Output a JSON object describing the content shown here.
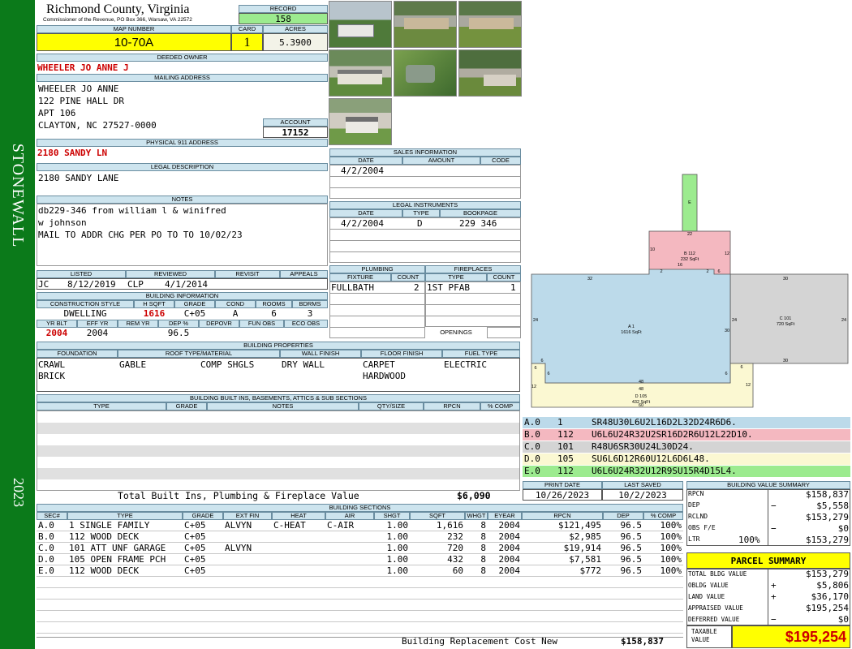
{
  "side_banner": {
    "district": "STONEWALL",
    "year": "2023"
  },
  "header": {
    "county": "Richmond County, Virginia",
    "address": "Commissioner of the Revenue, PO Box 366, Warsaw, VA 22572",
    "record_label": "RECORD",
    "record": "158",
    "map_number_label": "MAP NUMBER",
    "map_number": "10-70A",
    "card_label": "CARD",
    "card": "1",
    "acres_label": "ACRES",
    "acres": "5.3900"
  },
  "owner": {
    "deeded_owner_label": "DEEDED OWNER",
    "deeded_owner": "WHEELER JO ANNE J",
    "mailing_label": "MAILING ADDRESS",
    "mailing": [
      "WHEELER JO ANNE",
      "122 PINE HALL DR",
      "APT 106",
      "CLAYTON, NC 27527-0000"
    ],
    "account_label": "ACCOUNT",
    "account": "17152",
    "address911_label": "PHYSICAL 911 ADDRESS",
    "address911": "2180 SANDY LN",
    "legal_label": "LEGAL DESCRIPTION",
    "legal": "2180 SANDY LANE",
    "notes_label": "NOTES",
    "notes": [
      "db229-346 from william l & winifred",
      "w johnson",
      "MAIL TO ADDR CHG PER PO TO TO 10/02/23"
    ]
  },
  "review": {
    "headers": [
      "LISTED",
      "REVIEWED",
      "REVISIT",
      "APPEALS"
    ],
    "listed_by": "JC",
    "listed_date": "8/12/2019",
    "reviewed_by": "CLP",
    "reviewed_date": "4/1/2014"
  },
  "building_info": {
    "title": "BUILDING INFORMATION",
    "headers1": [
      "CONSTRUCTION STYLE",
      "H SQFT",
      "GRADE",
      "COND",
      "ROOMS",
      "BDRMS"
    ],
    "values1": [
      "DWELLING",
      "1616",
      "C+05",
      "A",
      "6",
      "3"
    ],
    "headers2": [
      "YR BLT",
      "EFF YR",
      "REM YR",
      "DEP %",
      "DEPOVR",
      "FUN OBS",
      "ECO OBS"
    ],
    "values2": [
      "2004",
      "2004",
      "",
      "96.5",
      "",
      "",
      ""
    ]
  },
  "properties": {
    "title": "BUILDING PROPERTIES",
    "headers": [
      "FOUNDATION",
      "ROOF TYPE/MATERIAL",
      "WALL FINISH",
      "FLOOR FINISH",
      "FUEL TYPE"
    ],
    "foundation": [
      "CRAWL",
      "BRICK"
    ],
    "roof_type": "GABLE",
    "roof_material": "COMP SHGLS",
    "wall": "DRY WALL",
    "floor": [
      "CARPET",
      "HARDWOOD"
    ],
    "fuel": "ELECTRIC"
  },
  "builtins": {
    "title": "BUILDING BUILT INS, BASEMENTS, ATTICS & SUB SECTIONS",
    "headers": [
      "TYPE",
      "GRADE",
      "NOTES",
      "QTY/SIZE",
      "RPCN",
      "% COMP"
    ],
    "total_label": "Total Built Ins, Plumbing & Fireplace Value",
    "total": "$6,090"
  },
  "sales": {
    "title": "SALES INFORMATION",
    "headers": [
      "DATE",
      "AMOUNT",
      "CODE"
    ],
    "date": "4/2/2004"
  },
  "instruments": {
    "title": "LEGAL INSTRUMENTS",
    "headers": [
      "DATE",
      "TYPE",
      "BOOKPAGE"
    ],
    "date": "4/2/2004",
    "type": "D",
    "bookpage": "229 346"
  },
  "plumbing": {
    "title": "PLUMBING",
    "headers": [
      "FIXTURE",
      "COUNT"
    ],
    "fixture": "FULLBATH",
    "count": "2"
  },
  "fireplaces": {
    "title": "FIREPLACES",
    "headers": [
      "TYPE",
      "COUNT"
    ],
    "type": "1ST PFAB",
    "count": "1",
    "openings_label": "OPENINGS"
  },
  "sketch": {
    "area_a": "A 1",
    "area_a_sqft": "1616 SqFt",
    "area_b": "B 112",
    "area_b_sqft": "232 SqFt",
    "area_c": "C 101",
    "area_c_sqft": "720 SqFt",
    "area_d": "D 105",
    "area_d_sqft": "432 SqFt",
    "area_e": "E",
    "dims": [
      "32",
      "30",
      "24",
      "24",
      "24",
      "12",
      "22",
      "10",
      "2",
      "16",
      "2",
      "6",
      "12",
      "30",
      "48",
      "48",
      "60",
      "6",
      "6",
      "6",
      "6",
      "12",
      "6",
      "30"
    ]
  },
  "vectors": [
    {
      "sec": "A.0",
      "code": "1",
      "vec": "SR48U30L6U2L16D2L32D24R6D6.",
      "color": "#bcdaea"
    },
    {
      "sec": "B.0",
      "code": "112",
      "vec": "U6L6U24R32U2SR16D2R6U12L22D10.",
      "color": "#f4b8c0"
    },
    {
      "sec": "C.0",
      "code": "101",
      "vec": "R48U6SR30U24L30D24.",
      "color": "#d4d4d4"
    },
    {
      "sec": "D.0",
      "code": "105",
      "vec": "SU6L6D12R60U12L6D6L48.",
      "color": "#fbf8d2"
    },
    {
      "sec": "E.0",
      "code": "112",
      "vec": "U6L6U24R32U12R9SU15R4D15L4.",
      "color": "#9ceb8f"
    }
  ],
  "dates": {
    "print_label": "PRINT DATE",
    "print": "10/26/2023",
    "saved_label": "LAST SAVED",
    "saved": "10/2/2023"
  },
  "sections": {
    "title": "BUILDING SECTIONS",
    "headers": [
      "SEC#",
      "TYPE",
      "GRADE",
      "EXT FIN",
      "HEAT",
      "AIR",
      "SHGT",
      "SQFT",
      "WHGT",
      "EYEAR",
      "RPCN",
      "DEP",
      "% COMP"
    ],
    "rows": [
      [
        "A.0",
        "1 SINGLE FAMILY",
        "C+05",
        "ALVYN",
        "C-HEAT",
        "C-AIR",
        "1.00",
        "1,616",
        "8",
        "2004",
        "$121,495",
        "96.5",
        "100%"
      ],
      [
        "B.0",
        "112 WOOD DECK",
        "C+05",
        "",
        "",
        "",
        "1.00",
        "232",
        "8",
        "2004",
        "$2,985",
        "96.5",
        "100%"
      ],
      [
        "C.0",
        "101 ATT UNF GARAGE",
        "C+05",
        "ALVYN",
        "",
        "",
        "1.00",
        "720",
        "8",
        "2004",
        "$19,914",
        "96.5",
        "100%"
      ],
      [
        "D.0",
        "105 OPEN FRAME PCH",
        "C+05",
        "",
        "",
        "",
        "1.00",
        "432",
        "8",
        "2004",
        "$7,581",
        "96.5",
        "100%"
      ],
      [
        "E.0",
        "112 WOOD DECK",
        "C+05",
        "",
        "",
        "",
        "1.00",
        "60",
        "8",
        "2004",
        "$772",
        "96.5",
        "100%"
      ]
    ],
    "brcn_label": "Building Replacement Cost New",
    "brcn": "$158,837"
  },
  "value_summary": {
    "title": "BUILDING VALUE SUMMARY",
    "rpcn_label": "RPCN",
    "rpcn": "$158,837",
    "dep_label": "DEP",
    "dep_sign": "−",
    "dep": "$5,558",
    "rclnd_label": "RCLND",
    "rclnd": "$153,279",
    "obs_label": "OBS F/E",
    "obs_sign": "−",
    "obs": "$0",
    "ltr_label": "LTR",
    "ltr_pct": "100%",
    "ltr": "$153,279"
  },
  "parcel": {
    "title": "PARCEL SUMMARY",
    "tbv_label": "TOTAL BLDG VALUE",
    "tbv": "$153,279",
    "obldg_label": "OBLDG VALUE",
    "obldg_sign": "+",
    "obldg": "$5,806",
    "land_label": "LAND VALUE",
    "land_sign": "+",
    "land": "$36,170",
    "appraised_label": "APPRAISED VALUE",
    "appraised": "$195,254",
    "deferred_label": "DEFERRED VALUE",
    "deferred_sign": "−",
    "deferred": "$0",
    "taxable_label": "TAXABLE VALUE",
    "taxable": "$195,254"
  }
}
